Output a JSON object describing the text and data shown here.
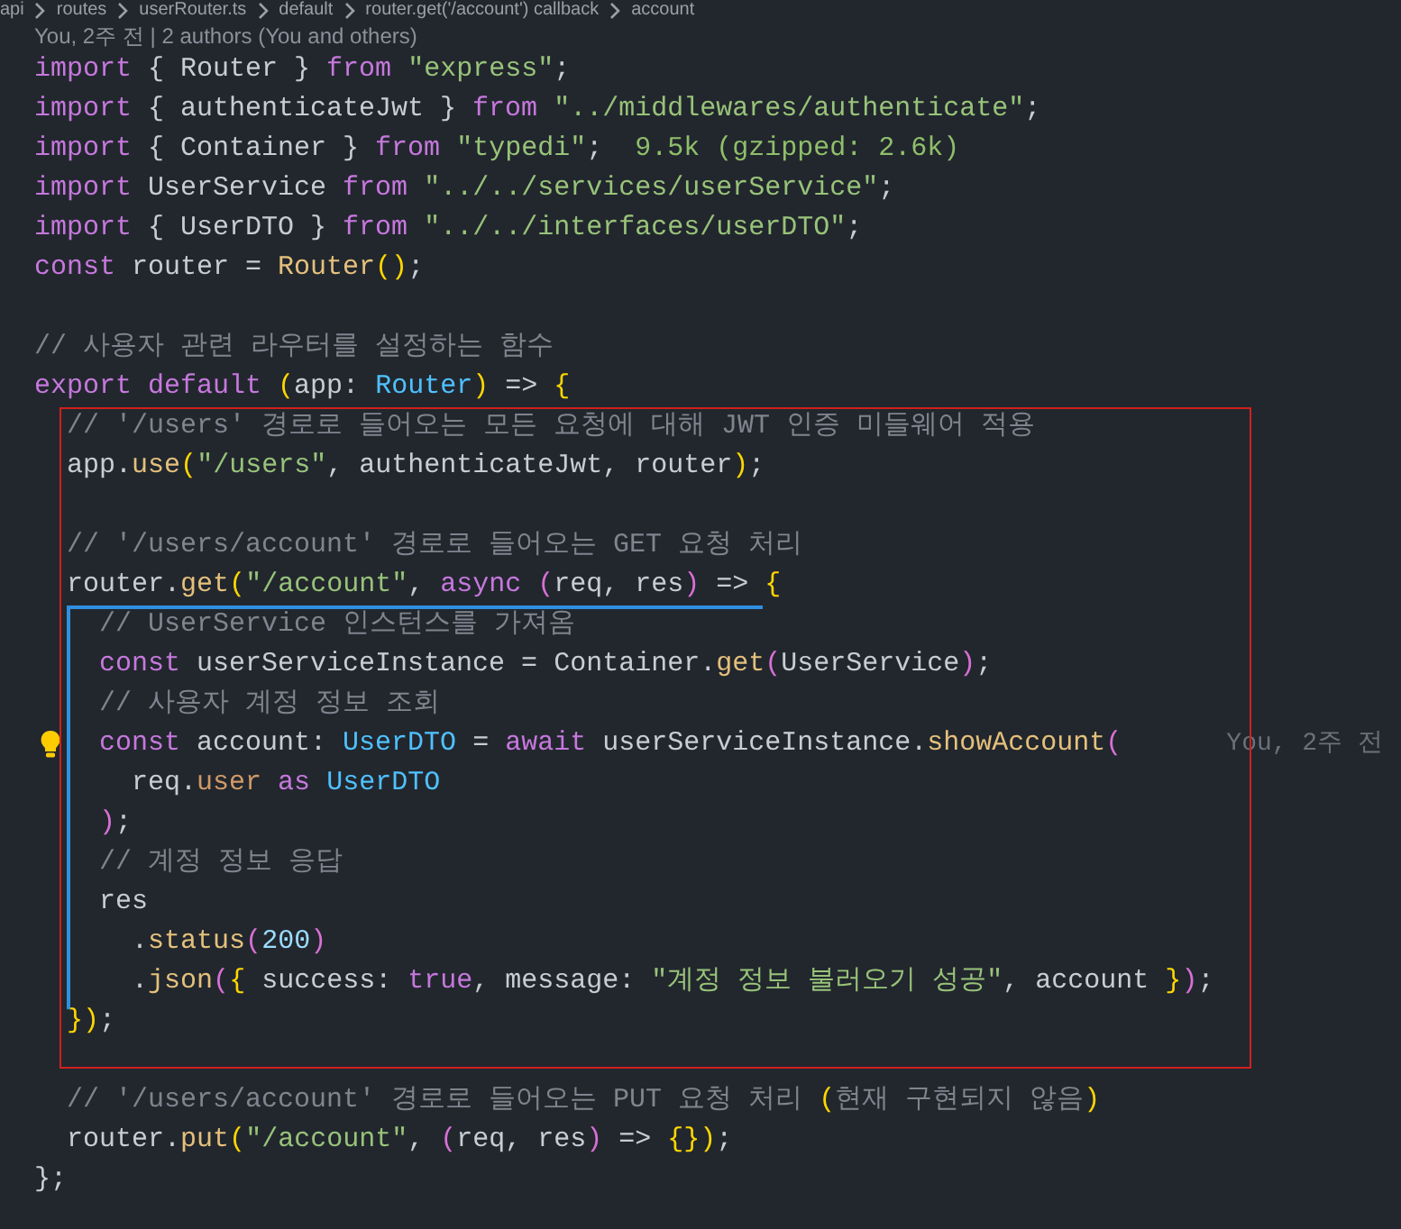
{
  "breadcrumb": [
    "api",
    "routes",
    "userRouter.ts",
    "default",
    "router.get('/account') callback",
    "account"
  ],
  "codelens": "You, 2주 전 | 2 authors (You and others)",
  "lines": [
    {
      "kind": "code",
      "tokens": [
        {
          "kind": "keyword",
          "text": "import"
        },
        {
          "kind": "plain",
          "text": " { Router } "
        },
        {
          "kind": "keyword",
          "text": "from"
        },
        {
          "kind": "string",
          "text": " \"express\""
        },
        {
          "kind": "plain",
          "text": ";"
        }
      ]
    },
    {
      "kind": "code",
      "tokens": [
        {
          "kind": "keyword",
          "text": "import"
        },
        {
          "kind": "plain",
          "text": " { authenticateJwt } "
        },
        {
          "kind": "keyword",
          "text": "from"
        },
        {
          "kind": "string",
          "text": " \"../middlewares/authenticate\""
        },
        {
          "kind": "plain",
          "text": ";"
        }
      ]
    },
    {
      "kind": "code",
      "tokens": [
        {
          "kind": "keyword",
          "text": "import"
        },
        {
          "kind": "plain",
          "text": " { Container } "
        },
        {
          "kind": "keyword",
          "text": "from"
        },
        {
          "kind": "string",
          "text": " \"typedi\""
        },
        {
          "kind": "plain",
          "text": ";"
        }
      ],
      "inlay": "9.5k (gzipped: 2.6k)"
    },
    {
      "kind": "code",
      "tokens": [
        {
          "kind": "keyword",
          "text": "import"
        },
        {
          "kind": "plain",
          "text": " UserService "
        },
        {
          "kind": "keyword",
          "text": "from"
        },
        {
          "kind": "string",
          "text": " \"../../services/userService\""
        },
        {
          "kind": "plain",
          "text": ";"
        }
      ]
    },
    {
      "kind": "code",
      "tokens": [
        {
          "kind": "keyword",
          "text": "import"
        },
        {
          "kind": "plain",
          "text": " { UserDTO } "
        },
        {
          "kind": "keyword",
          "text": "from"
        },
        {
          "kind": "string",
          "text": " \"../../interfaces/userDTO\""
        },
        {
          "kind": "plain",
          "text": ";"
        }
      ]
    },
    {
      "kind": "code",
      "tokens": [
        {
          "kind": "keyword",
          "text": "const"
        },
        {
          "kind": "plain",
          "text": " router = "
        },
        {
          "kind": "function",
          "text": "Router"
        },
        {
          "kind": "bracket1",
          "text": "()"
        },
        {
          "kind": "plain",
          "text": ";"
        }
      ]
    },
    {
      "kind": "blank"
    },
    {
      "kind": "code",
      "tokens": [
        {
          "kind": "comment",
          "text": "// 사용자 관련 라우터를 설정하는 함수"
        }
      ]
    },
    {
      "kind": "code",
      "tokens": [
        {
          "kind": "keyword",
          "text": "export default"
        },
        {
          "kind": "bracket1",
          "text": " ("
        },
        {
          "kind": "plain",
          "text": "app: "
        },
        {
          "kind": "type",
          "text": "Router"
        },
        {
          "kind": "bracket1",
          "text": ")"
        },
        {
          "kind": "plain",
          "text": " => "
        },
        {
          "kind": "bracket1",
          "text": "{"
        }
      ]
    },
    {
      "kind": "code",
      "tokens": [
        {
          "kind": "comment",
          "text": "  // '/users' 경로로 들어오는 모든 요청에 대해 JWT 인증 미들웨어 적용"
        }
      ]
    },
    {
      "kind": "code",
      "tokens": [
        {
          "kind": "plain",
          "text": "  app."
        },
        {
          "kind": "function",
          "text": "use"
        },
        {
          "kind": "bracket1",
          "text": "("
        },
        {
          "kind": "string",
          "text": "\"/users\""
        },
        {
          "kind": "plain",
          "text": ", authenticateJwt, router"
        },
        {
          "kind": "bracket1",
          "text": ")"
        },
        {
          "kind": "plain",
          "text": ";"
        }
      ]
    },
    {
      "kind": "blank"
    },
    {
      "kind": "code",
      "tokens": [
        {
          "kind": "comment",
          "text": "  // '/users/account' 경로로 들어오는 GET 요청 처리"
        }
      ]
    },
    {
      "kind": "code",
      "tokens": [
        {
          "kind": "plain",
          "text": "  router."
        },
        {
          "kind": "function",
          "text": "get"
        },
        {
          "kind": "bracket1",
          "text": "("
        },
        {
          "kind": "string",
          "text": "\"/account\""
        },
        {
          "kind": "plain",
          "text": ", "
        },
        {
          "kind": "keyword",
          "text": "async"
        },
        {
          "kind": "bracket2",
          "text": " ("
        },
        {
          "kind": "plain",
          "text": "req, res"
        },
        {
          "kind": "bracket2",
          "text": ")"
        },
        {
          "kind": "plain",
          "text": " => "
        },
        {
          "kind": "bracket1",
          "text": "{"
        }
      ]
    },
    {
      "kind": "code",
      "tokens": [
        {
          "kind": "comment",
          "text": "    // UserService 인스턴스를 가져옴"
        }
      ]
    },
    {
      "kind": "code",
      "tokens": [
        {
          "kind": "keyword",
          "text": "    const"
        },
        {
          "kind": "plain",
          "text": " userServiceInstance = Container."
        },
        {
          "kind": "function",
          "text": "get"
        },
        {
          "kind": "bracket2",
          "text": "("
        },
        {
          "kind": "plain",
          "text": "UserService"
        },
        {
          "kind": "bracket2",
          "text": ")"
        },
        {
          "kind": "plain",
          "text": ";"
        }
      ]
    },
    {
      "kind": "code",
      "tokens": [
        {
          "kind": "comment",
          "text": "    // 사용자 계정 정보 조회"
        }
      ]
    },
    {
      "kind": "code",
      "tokens": [
        {
          "kind": "keyword",
          "text": "    const"
        },
        {
          "kind": "plain",
          "text": " account: "
        },
        {
          "kind": "type",
          "text": "UserDTO"
        },
        {
          "kind": "plain",
          "text": " = "
        },
        {
          "kind": "keyword",
          "text": "await"
        },
        {
          "kind": "plain",
          "text": " userServiceInstance."
        },
        {
          "kind": "function",
          "text": "showAccount"
        },
        {
          "kind": "bracket2",
          "text": "("
        }
      ],
      "blame": "You, 2주 전",
      "lightbulb": true
    },
    {
      "kind": "code",
      "tokens": [
        {
          "kind": "plain",
          "text": "      req."
        },
        {
          "kind": "property",
          "text": "user"
        },
        {
          "kind": "keyword",
          "text": " as"
        },
        {
          "kind": "type",
          "text": " UserDTO"
        }
      ]
    },
    {
      "kind": "code",
      "tokens": [
        {
          "kind": "bracket2",
          "text": "    )"
        },
        {
          "kind": "plain",
          "text": ";"
        }
      ]
    },
    {
      "kind": "code",
      "tokens": [
        {
          "kind": "comment",
          "text": "    // 계정 정보 응답"
        }
      ]
    },
    {
      "kind": "code",
      "tokens": [
        {
          "kind": "plain",
          "text": "    res"
        }
      ]
    },
    {
      "kind": "code",
      "tokens": [
        {
          "kind": "plain",
          "text": "      ."
        },
        {
          "kind": "function",
          "text": "status"
        },
        {
          "kind": "bracket2",
          "text": "("
        },
        {
          "kind": "number",
          "text": "200"
        },
        {
          "kind": "bracket2",
          "text": ")"
        }
      ]
    },
    {
      "kind": "code",
      "tokens": [
        {
          "kind": "plain",
          "text": "      ."
        },
        {
          "kind": "function",
          "text": "json"
        },
        {
          "kind": "bracket2",
          "text": "("
        },
        {
          "kind": "bracket1",
          "text": "{"
        },
        {
          "kind": "plain",
          "text": " success: "
        },
        {
          "kind": "keyword",
          "text": "true"
        },
        {
          "kind": "plain",
          "text": ", message: "
        },
        {
          "kind": "string",
          "text": "\"계정 정보 불러오기 성공\""
        },
        {
          "kind": "plain",
          "text": ", account "
        },
        {
          "kind": "bracket1",
          "text": "}"
        },
        {
          "kind": "bracket2",
          "text": ")"
        },
        {
          "kind": "plain",
          "text": ";"
        }
      ]
    },
    {
      "kind": "code",
      "tokens": [
        {
          "kind": "bracket1",
          "text": "  })"
        },
        {
          "kind": "plain",
          "text": ";"
        }
      ]
    },
    {
      "kind": "blank"
    },
    {
      "kind": "code",
      "tokens": [
        {
          "kind": "comment",
          "text": "  // '/users/account' 경로로 들어오는 PUT 요청 처리 "
        },
        {
          "kind": "bracket1",
          "text": "("
        },
        {
          "kind": "comment",
          "text": "현재 구현되지 않음"
        },
        {
          "kind": "bracket1",
          "text": ")"
        }
      ]
    },
    {
      "kind": "code",
      "tokens": [
        {
          "kind": "plain",
          "text": "  router."
        },
        {
          "kind": "function",
          "text": "put"
        },
        {
          "kind": "bracket1",
          "text": "("
        },
        {
          "kind": "string",
          "text": "\"/account\""
        },
        {
          "kind": "plain",
          "text": ", "
        },
        {
          "kind": "bracket2",
          "text": "("
        },
        {
          "kind": "plain",
          "text": "req, res"
        },
        {
          "kind": "bracket2",
          "text": ")"
        },
        {
          "kind": "plain",
          "text": " => "
        },
        {
          "kind": "bracket1",
          "text": "{})"
        },
        {
          "kind": "plain",
          "text": ";"
        }
      ]
    },
    {
      "kind": "code",
      "tokens": [
        {
          "kind": "plain",
          "text": "};"
        }
      ]
    }
  ]
}
